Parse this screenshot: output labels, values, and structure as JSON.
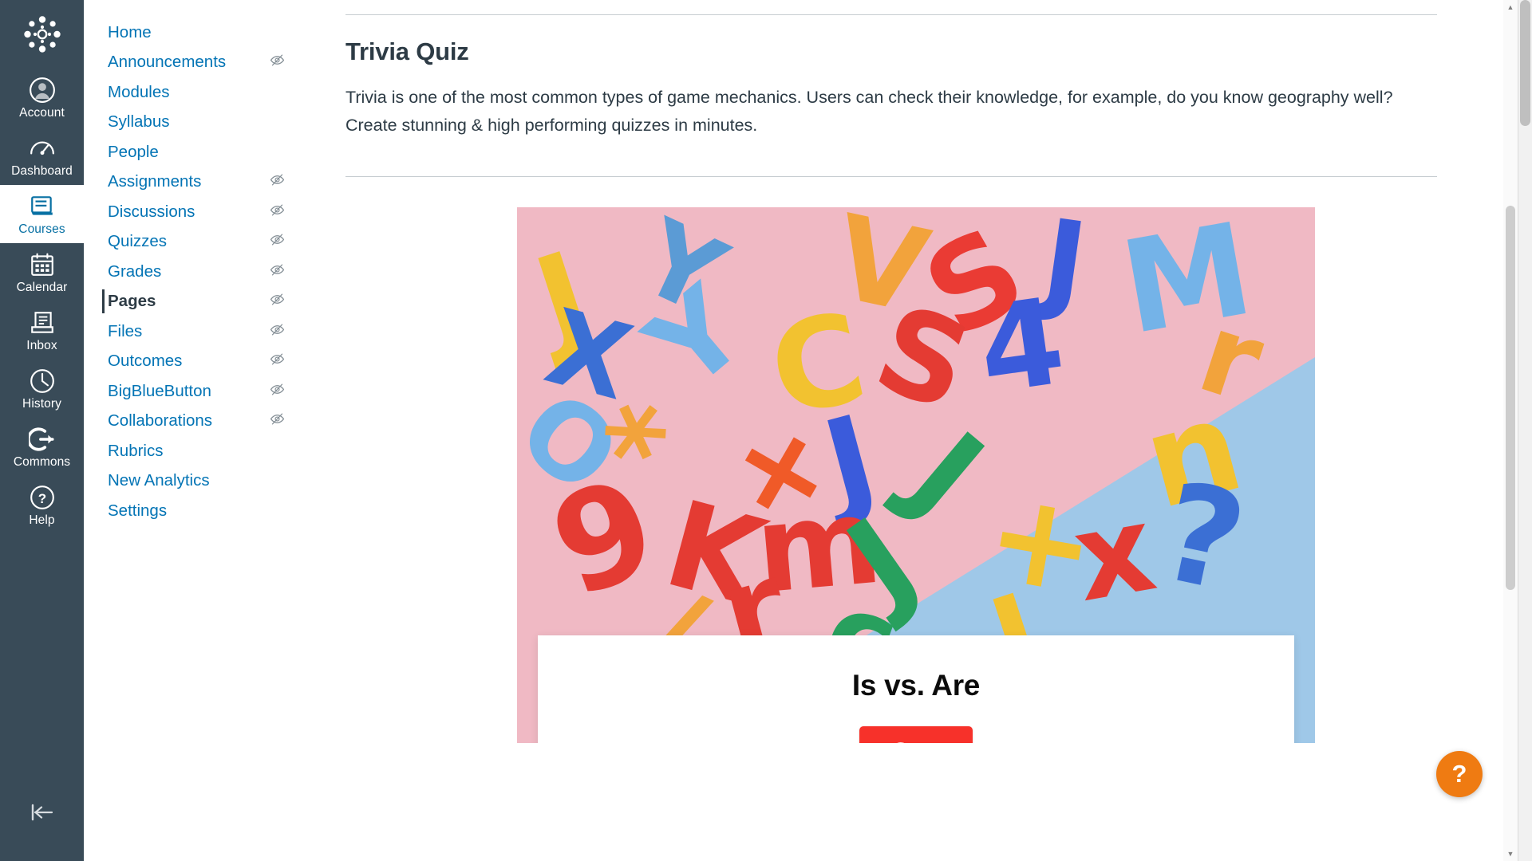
{
  "global_nav": {
    "logo_name": "canvas-logo",
    "items": [
      {
        "label": "Account",
        "icon": "user-circle-icon",
        "active": false
      },
      {
        "label": "Dashboard",
        "icon": "gauge-icon",
        "active": false
      },
      {
        "label": "Courses",
        "icon": "book-icon",
        "active": true
      },
      {
        "label": "Calendar",
        "icon": "calendar-icon",
        "active": false
      },
      {
        "label": "Inbox",
        "icon": "inbox-icon",
        "active": false
      },
      {
        "label": "History",
        "icon": "clock-icon",
        "active": false
      },
      {
        "label": "Commons",
        "icon": "arrow-right-exit-icon",
        "active": false
      },
      {
        "label": "Help",
        "icon": "help-circle-icon",
        "active": false
      }
    ],
    "collapse_icon": "collapse-left-icon",
    "active_color": "#0770A3",
    "background_color": "#394B58"
  },
  "course_nav": {
    "link_color": "#0374B5",
    "active_color": "#2D3B45",
    "items": [
      {
        "label": "Home",
        "hidden_icon": false,
        "active": false
      },
      {
        "label": "Announcements",
        "hidden_icon": true,
        "active": false
      },
      {
        "label": "Modules",
        "hidden_icon": false,
        "active": false
      },
      {
        "label": "Syllabus",
        "hidden_icon": false,
        "active": false
      },
      {
        "label": "People",
        "hidden_icon": false,
        "active": false
      },
      {
        "label": "Assignments",
        "hidden_icon": true,
        "active": false
      },
      {
        "label": "Discussions",
        "hidden_icon": true,
        "active": false
      },
      {
        "label": "Quizzes",
        "hidden_icon": true,
        "active": false
      },
      {
        "label": "Grades",
        "hidden_icon": true,
        "active": false
      },
      {
        "label": "Pages",
        "hidden_icon": true,
        "active": true
      },
      {
        "label": "Files",
        "hidden_icon": true,
        "active": false
      },
      {
        "label": "Outcomes",
        "hidden_icon": true,
        "active": false
      },
      {
        "label": "BigBlueButton",
        "hidden_icon": true,
        "active": false
      },
      {
        "label": "Collaborations",
        "hidden_icon": true,
        "active": false
      },
      {
        "label": "Rubrics",
        "hidden_icon": false,
        "active": false
      },
      {
        "label": "New Analytics",
        "hidden_icon": false,
        "active": false
      },
      {
        "label": "Settings",
        "hidden_icon": false,
        "active": false
      }
    ]
  },
  "main": {
    "title": "Trivia Quiz",
    "body": "Trivia is one of the most common types of game mechanics. Users can check their knowledge, for example, do you know geography well? Create stunning & high performing quizzes in minutes.",
    "quiz": {
      "card_title": "Is vs. Are",
      "start_label": "Start",
      "start_color": "#F7312A",
      "image_alt": "colorful plastic alphabet letters on pink and blue background"
    }
  },
  "help_button": {
    "icon": "question-mark-icon",
    "color": "#EF7B12"
  }
}
